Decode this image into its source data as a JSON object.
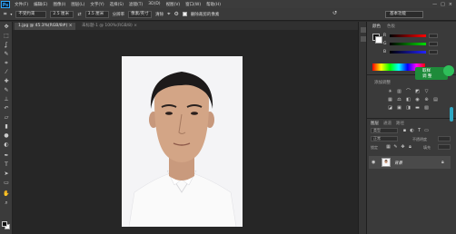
{
  "app": {
    "logo": "Ps"
  },
  "menu": [
    "文件(F)",
    "编辑(E)",
    "图像(I)",
    "图层(L)",
    "文字(Y)",
    "选择(S)",
    "滤镜(T)",
    "3D(D)",
    "视图(V)",
    "窗口(W)",
    "帮助(H)"
  ],
  "window_controls": [
    "—",
    "□",
    "×"
  ],
  "options_bar": {
    "mode_value": "不受约束",
    "width_value": "2.5 厘米",
    "height_value": "3.5 厘米",
    "resolution_label": "分辨率",
    "resolution_value": "像素/英寸",
    "clear_label": "清除",
    "delete_cropped_label": "删除裁剪的像素",
    "workspace_value": "基本功能"
  },
  "tabs": {
    "active": "1.jpg @ 45.3%(RGB/8#) ×",
    "inactive": "未标题-1 @ 100%(RGB/8) ×"
  },
  "panel": {
    "color_tab": "颜色",
    "swatches_tab": "色板",
    "channels": [
      "R",
      "G",
      "B"
    ],
    "tooltip_line1": "取样",
    "tooltip_line2": "调 整",
    "adjustments_title": "添加调整",
    "layers_tab": "图层",
    "channels_tab": "通道",
    "paths_tab": "路径",
    "kind_filter": "类型",
    "blend_mode": "正常",
    "opacity_label": "不透明度",
    "lock_label": "锁定",
    "fill_label": "填充",
    "layer_name": "背景"
  },
  "colors": {
    "accent_teal": "#2fa9c4",
    "tooltip_green": "#1e8b3a",
    "photo_bg": "#f4f4f6"
  },
  "icons": {
    "tools": [
      "move-icon",
      "marquee-icon",
      "lasso-icon",
      "quick-select-icon",
      "crop-icon",
      "eyedropper-icon",
      "healing-icon",
      "brush-icon",
      "stamp-icon",
      "history-brush-icon",
      "eraser-icon",
      "gradient-icon",
      "blur-icon",
      "dodge-icon",
      "pen-icon",
      "type-icon",
      "path-select-icon",
      "shape-icon",
      "hand-icon",
      "zoom-icon"
    ]
  }
}
